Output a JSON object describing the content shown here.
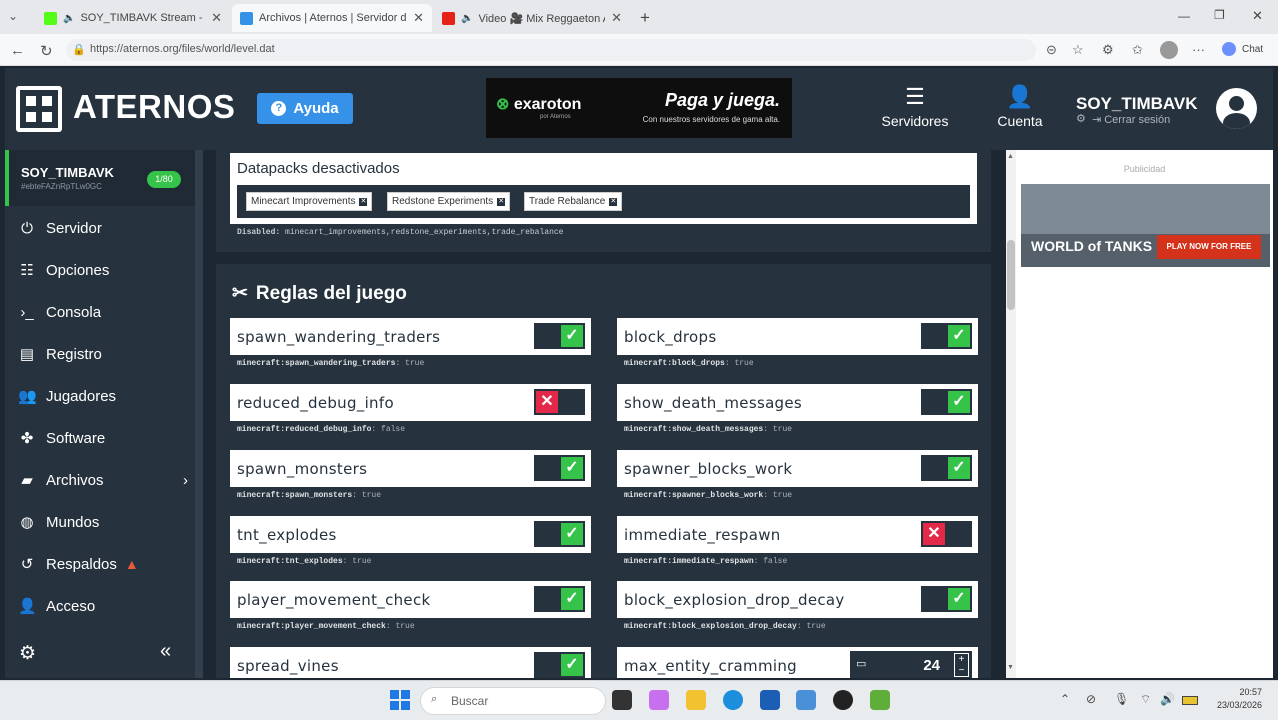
{
  "browser": {
    "tabs": [
      {
        "title": "SOY_TIMBAVK Stream - Watc"
      },
      {
        "title": "Archivos | Aternos | Servidor de M"
      },
      {
        "title": "Video 🎥 Mix Reggaeton Anti"
      }
    ],
    "new_tab": "+",
    "url": "https://aternos.org/files/world/level.dat",
    "chat_label": "Chat"
  },
  "header": {
    "brand": "ATERNOS",
    "help_label": "Ayuda",
    "ad": {
      "logo": "exaroton",
      "logo_sub": "por Aternos",
      "headline": "Paga y juega.",
      "sub": "Con nuestros servidores de gama alta."
    },
    "servers_label": "Servidores",
    "account_label": "Cuenta",
    "username": "SOY_TIMBAVK",
    "logout_label": "Cerrar sesión"
  },
  "sidebar": {
    "server_name": "SOY_TIMBAVK",
    "server_id": "#ebteFAZnRpTLw0GC",
    "player_count": "1/80",
    "items": [
      {
        "label": "Servidor",
        "icon": "power-icon"
      },
      {
        "label": "Opciones",
        "icon": "options-icon"
      },
      {
        "label": "Consola",
        "icon": "terminal-icon"
      },
      {
        "label": "Registro",
        "icon": "document-icon"
      },
      {
        "label": "Jugadores",
        "icon": "users-icon"
      },
      {
        "label": "Software",
        "icon": "puzzle-icon"
      },
      {
        "label": "Archivos",
        "icon": "folder-icon"
      },
      {
        "label": "Mundos",
        "icon": "globe-icon"
      },
      {
        "label": "Respaldos",
        "icon": "history-icon"
      },
      {
        "label": "Acceso",
        "icon": "user-lock-icon"
      }
    ]
  },
  "datapacks": {
    "title": "Datapacks desactivados",
    "tags": [
      "Minecart Improvements",
      "Redstone Experiments",
      "Trade Rebalance"
    ],
    "note_label": "Disabled:",
    "note_value": "minecart_improvements,redstone_experiments,trade_rebalance"
  },
  "rules": {
    "title": "Reglas del juego",
    "items": [
      {
        "name": "spawn_wandering_traders",
        "key": "minecraft:spawn_wandering_traders",
        "value": "true"
      },
      {
        "name": "block_drops",
        "key": "minecraft:block_drops",
        "value": "true"
      },
      {
        "name": "reduced_debug_info",
        "key": "minecraft:reduced_debug_info",
        "value": "false"
      },
      {
        "name": "show_death_messages",
        "key": "minecraft:show_death_messages",
        "value": "true"
      },
      {
        "name": "spawn_monsters",
        "key": "minecraft:spawn_monsters",
        "value": "true"
      },
      {
        "name": "spawner_blocks_work",
        "key": "minecraft:spawner_blocks_work",
        "value": "true"
      },
      {
        "name": "tnt_explodes",
        "key": "minecraft:tnt_explodes",
        "value": "true"
      },
      {
        "name": "immediate_respawn",
        "key": "minecraft:immediate_respawn",
        "value": "false"
      },
      {
        "name": "player_movement_check",
        "key": "minecraft:player_movement_check",
        "value": "true"
      },
      {
        "name": "block_explosion_drop_decay",
        "key": "minecraft:block_explosion_drop_decay",
        "value": "true"
      },
      {
        "name": "spread_vines",
        "key": "",
        "value": "true"
      },
      {
        "name": "max_entity_cramming",
        "key": "",
        "value": "24"
      }
    ]
  },
  "right_ad": {
    "label": "Publicidad",
    "brand": "WORLD of TANKS",
    "cta": "PLAY NOW FOR FREE"
  },
  "taskbar": {
    "search_placeholder": "Buscar",
    "time": "20:57",
    "date": "23/03/2026"
  },
  "colors": {
    "accent_green": "#36c34a",
    "accent_red": "#e3284a",
    "dark": "#26323d",
    "help_blue": "#3592e8"
  }
}
